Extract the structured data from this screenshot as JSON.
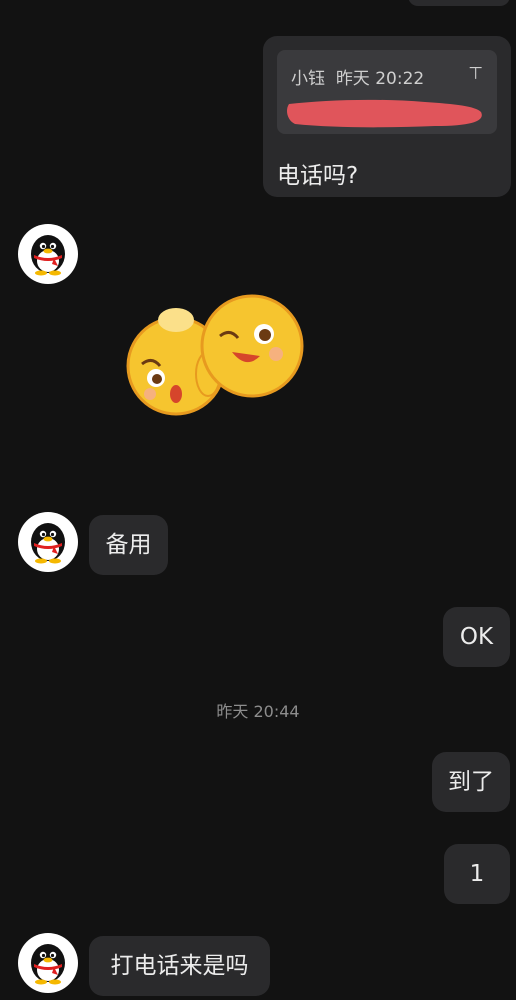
{
  "reply": {
    "quoted_sender": "小钰",
    "quoted_time": "昨天 20:22",
    "top_icon": "pin-top-icon",
    "top_glyph": "⊤",
    "text": "电话吗?"
  },
  "sticker": {
    "icon": "two-emoji-faces-sticker"
  },
  "messages": {
    "backup": "备用",
    "ok": "OK",
    "arrived": "到了",
    "one": "1",
    "call_question": "打电话来是吗"
  },
  "timestamp": "昨天 20:44",
  "colors": {
    "background": "#121212",
    "bubble": "#2a2a2c",
    "quote": "#3a3a3d",
    "redaction": "#e0555b",
    "emoji_yellow": "#f6c52f"
  }
}
